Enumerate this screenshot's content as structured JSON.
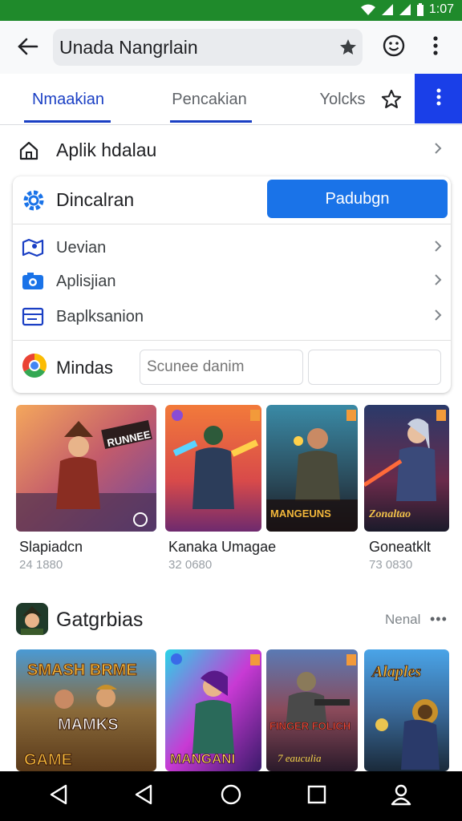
{
  "status_bar": {
    "time": "1:07"
  },
  "app_bar": {
    "url_value": "Unada Nangrlain"
  },
  "tabs": [
    {
      "label": "Nmaakian"
    },
    {
      "label": "Pencakian"
    },
    {
      "label": "Yolcks"
    }
  ],
  "nav_row": {
    "label": "Aplik hdalau"
  },
  "card": {
    "title": "Dincalran",
    "button_label": "Padubgn",
    "items": [
      {
        "label": "Uevian"
      },
      {
        "label": "Aplisjian"
      },
      {
        "label": "Baplksanion"
      }
    ],
    "browser_label": "Mindas",
    "search_placeholder": "Scunee danim"
  },
  "apps": [
    {
      "name": "Slapiadcn",
      "meta": "24 1880",
      "tile_text": "RUNNEE"
    },
    {
      "name": "Kanaka Umagae",
      "meta": "32 0680",
      "tile_text": ""
    },
    {
      "name": "",
      "meta": "",
      "tile_text": "MANGEUNS"
    },
    {
      "name": "Goneatklt",
      "meta": "73 0830",
      "tile_text": "Zonaltao"
    }
  ],
  "section": {
    "title": "Gatgrbias",
    "more_label": "Nenal",
    "dots": "•••"
  },
  "games": [
    {
      "tile_title": "SMASH BRME",
      "tile_text": "MAMKS",
      "tile_footer": "GAME"
    },
    {
      "tile_text": "MANGANI"
    },
    {
      "tile_text": "FINGER FOLICH",
      "tile_footer": "7 eauculia"
    },
    {
      "tile_title": "Alaples"
    }
  ],
  "colors": {
    "status_green": "#1f8a2b",
    "accent_blue": "#1a73e8",
    "tab_blue": "#1a3fc4",
    "menu_blue": "#1a3fe8"
  },
  "icons": [
    "wifi-icon",
    "signal-icon",
    "battery-icon",
    "back-arrow-icon",
    "star-icon",
    "smiley-icon",
    "more-vert-icon",
    "home-icon",
    "gear-icon",
    "chevron-right-icon",
    "chrome-icon",
    "triangle-back-icon",
    "circle-home-icon",
    "square-recents-icon",
    "person-icon"
  ]
}
